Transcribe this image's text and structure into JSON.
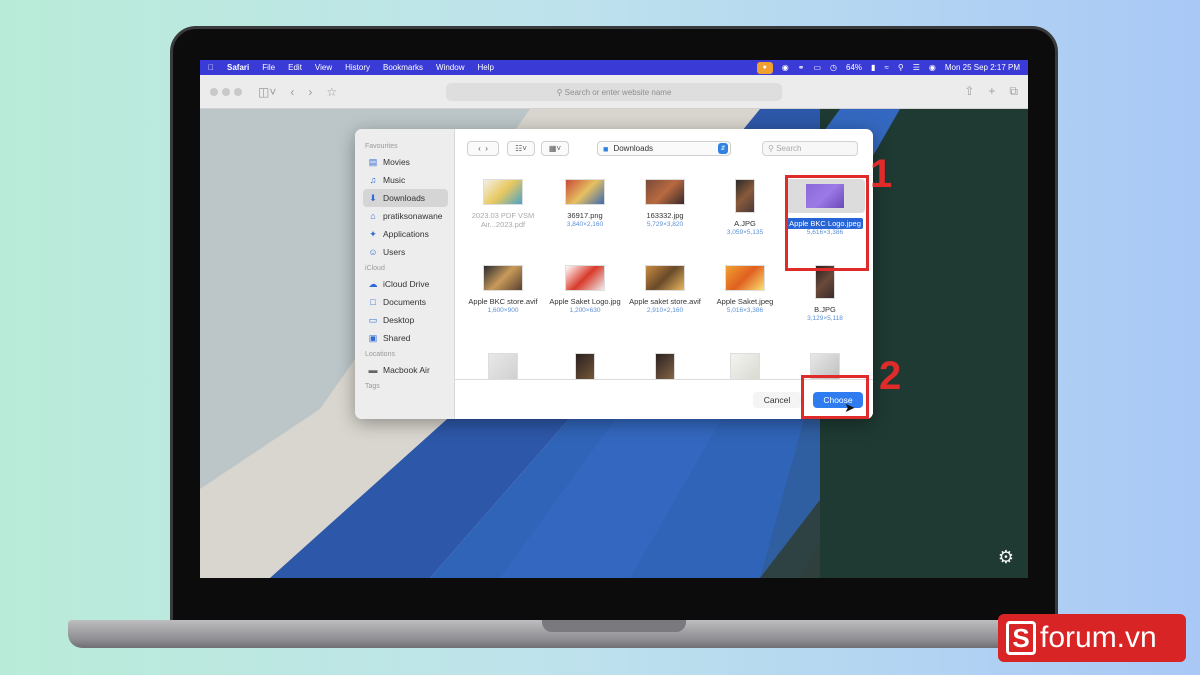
{
  "menubar": {
    "apple_icon": "apple-icon",
    "items": [
      "Safari",
      "File",
      "Edit",
      "View",
      "History",
      "Bookmarks",
      "Window",
      "Help"
    ],
    "battery": "64%",
    "datetime": "Mon 25 Sep  2:17 PM"
  },
  "safari": {
    "address_placeholder": "Search or enter website name"
  },
  "dialog": {
    "sidebar": {
      "favourites_header": "Favourites",
      "favourites": [
        {
          "label": "Movies",
          "icon": "film-icon"
        },
        {
          "label": "Music",
          "icon": "music-icon"
        },
        {
          "label": "Downloads",
          "icon": "download-icon"
        },
        {
          "label": "pratiksonawane",
          "icon": "home-icon"
        },
        {
          "label": "Applications",
          "icon": "applications-icon"
        },
        {
          "label": "Users",
          "icon": "users-icon"
        }
      ],
      "icloud_header": "iCloud",
      "icloud": [
        {
          "label": "iCloud Drive",
          "icon": "cloud-icon"
        },
        {
          "label": "Documents",
          "icon": "document-icon"
        },
        {
          "label": "Desktop",
          "icon": "desktop-icon"
        },
        {
          "label": "Shared",
          "icon": "shared-folder-icon"
        }
      ],
      "locations_header": "Locations",
      "locations": [
        {
          "label": "Macbook Air",
          "icon": "laptop-icon"
        }
      ],
      "tags_header": "Tags"
    },
    "toolbar": {
      "location": "Downloads",
      "search_placeholder": "Search"
    },
    "files": [
      {
        "name": "2023.03 PDF VSM Air...2023.pdf",
        "dims": "",
        "dim": true,
        "colors": [
          "#f3f0e6",
          "#e8c860",
          "#4aa3c8"
        ]
      },
      {
        "name": "36917.png",
        "dims": "3,840×2,160",
        "dim": false,
        "colors": [
          "#c84a3a",
          "#e6c060",
          "#3a6ab0"
        ]
      },
      {
        "name": "163332.jpg",
        "dims": "5,729×3,820",
        "dim": false,
        "colors": [
          "#7a4a3a",
          "#b86a40",
          "#3a2a2a"
        ]
      },
      {
        "name": "A.JPG",
        "dims": "3,059×5,135",
        "dim": false,
        "colors": [
          "#2a2a2a",
          "#8a5a3a",
          "#4a3a3a"
        ]
      },
      {
        "name": "Apple BKC Logo.jpeg",
        "dims": "5,616×3,386",
        "dim": false,
        "selected": true,
        "colors": [
          "#8a68d8",
          "#9c7ae6",
          "#6a4ab8"
        ]
      },
      {
        "name": "Apple BKC store.avif",
        "dims": "1,600×900",
        "dim": false,
        "colors": [
          "#2a2a30",
          "#c89a5a",
          "#5a4030"
        ]
      },
      {
        "name": "Apple Saket Logo.jpg",
        "dims": "1,200×630",
        "dim": false,
        "colors": [
          "#ffffff",
          "#d83a2a",
          "#eeeeee"
        ]
      },
      {
        "name": "Apple saket store.avif",
        "dims": "2,910×2,160",
        "dim": false,
        "colors": [
          "#c88a40",
          "#6a4a2a",
          "#e8b860"
        ]
      },
      {
        "name": "Apple Saket.jpeg",
        "dims": "5,016×3,386",
        "dim": false,
        "colors": [
          "#f0a030",
          "#e06020",
          "#fce070"
        ]
      },
      {
        "name": "B.JPG",
        "dims": "3,129×5,118",
        "dim": false,
        "colors": [
          "#2a2020",
          "#6a4a3a",
          "#3a2a2a"
        ]
      }
    ],
    "partial_row": [
      {
        "colors": [
          "#e8e8e8",
          "#cfcfcf"
        ]
      },
      {
        "colors": [
          "#2a2020",
          "#7a5a3a"
        ]
      },
      {
        "colors": [
          "#2a2020",
          "#8a6a4a"
        ]
      },
      {
        "colors": [
          "#f4f4f0",
          "#d8d8d0"
        ]
      },
      {
        "colors": [
          "#e8e8e8",
          "#bdbdbd"
        ]
      }
    ],
    "cancel_label": "Cancel",
    "choose_label": "Choose"
  },
  "annotations": {
    "step1": "1",
    "step2": "2"
  },
  "watermark": {
    "logo_letter": "S",
    "text": "forum.vn"
  }
}
